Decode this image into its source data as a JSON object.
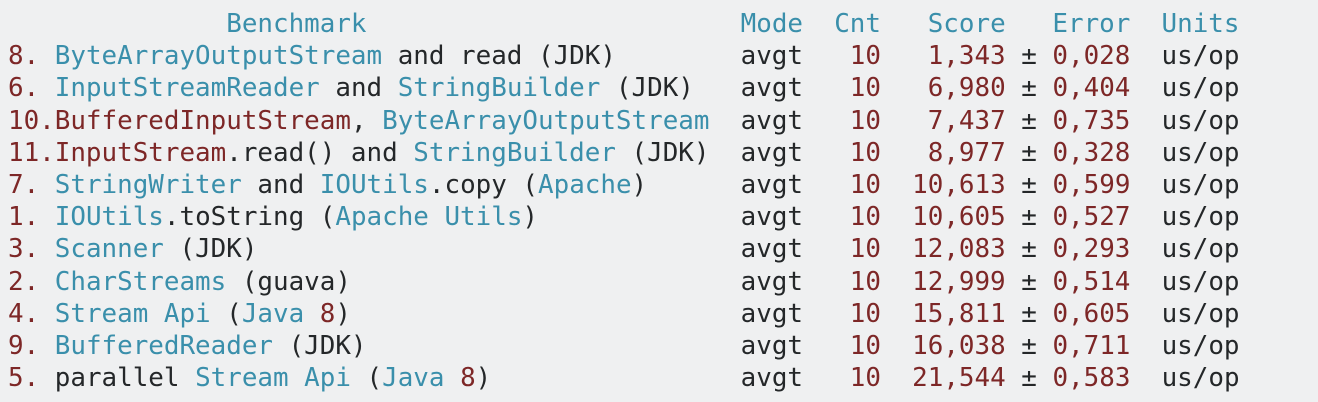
{
  "colors": {
    "teal": "#3a8fab",
    "red": "#7d2727",
    "text": "#242729",
    "background": "#eff0f1"
  },
  "header": {
    "benchmark": "Benchmark",
    "mode": "Mode",
    "cnt": "Cnt",
    "score": "Score",
    "error": "Error",
    "units": "Units",
    "plusminus": "±"
  },
  "rows": [
    {
      "name": [
        [
          "8. ",
          "r"
        ],
        [
          "ByteArrayOutputStream",
          "t"
        ],
        [
          " and read (JDK)",
          "k"
        ]
      ],
      "mode": "avgt",
      "cnt": "10",
      "score": "1,343",
      "error": "0,028",
      "units": "us/op"
    },
    {
      "name": [
        [
          "6. ",
          "r"
        ],
        [
          "InputStreamReader",
          "t"
        ],
        [
          " and ",
          "k"
        ],
        [
          "StringBuilder",
          "t"
        ],
        [
          " (JDK)",
          "k"
        ]
      ],
      "mode": "avgt",
      "cnt": "10",
      "score": "6,980",
      "error": "0,404",
      "units": "us/op"
    },
    {
      "name": [
        [
          "10.BufferedInputStream",
          "r"
        ],
        [
          ", ",
          "k"
        ],
        [
          "ByteArrayOutputStream",
          "t"
        ]
      ],
      "mode": "avgt",
      "cnt": "10",
      "score": "7,437",
      "error": "0,735",
      "units": "us/op"
    },
    {
      "name": [
        [
          "11.InputStream",
          "r"
        ],
        [
          ".read() and ",
          "k"
        ],
        [
          "StringBuilder",
          "t"
        ],
        [
          " (JDK)",
          "k"
        ]
      ],
      "mode": "avgt",
      "cnt": "10",
      "score": "8,977",
      "error": "0,328",
      "units": "us/op"
    },
    {
      "name": [
        [
          "7. ",
          "r"
        ],
        [
          "StringWriter",
          "t"
        ],
        [
          " and ",
          "k"
        ],
        [
          "IOUtils",
          "t"
        ],
        [
          ".copy (",
          "k"
        ],
        [
          "Apache",
          "t"
        ],
        [
          ")",
          "k"
        ]
      ],
      "mode": "avgt",
      "cnt": "10",
      "score": "10,613",
      "error": "0,599",
      "units": "us/op"
    },
    {
      "name": [
        [
          "1. ",
          "r"
        ],
        [
          "IOUtils",
          "t"
        ],
        [
          ".toString (",
          "k"
        ],
        [
          "Apache Utils",
          "t"
        ],
        [
          ")",
          "k"
        ]
      ],
      "mode": "avgt",
      "cnt": "10",
      "score": "10,605",
      "error": "0,527",
      "units": "us/op"
    },
    {
      "name": [
        [
          "3. ",
          "r"
        ],
        [
          "Scanner",
          "t"
        ],
        [
          " (JDK)",
          "k"
        ]
      ],
      "mode": "avgt",
      "cnt": "10",
      "score": "12,083",
      "error": "0,293",
      "units": "us/op"
    },
    {
      "name": [
        [
          "2. ",
          "r"
        ],
        [
          "CharStreams",
          "t"
        ],
        [
          " (guava)",
          "k"
        ]
      ],
      "mode": "avgt",
      "cnt": "10",
      "score": "12,999",
      "error": "0,514",
      "units": "us/op"
    },
    {
      "name": [
        [
          "4. ",
          "r"
        ],
        [
          "Stream Api",
          "t"
        ],
        [
          " (",
          "k"
        ],
        [
          "Java ",
          "t"
        ],
        [
          "8",
          "r"
        ],
        [
          ")",
          "k"
        ]
      ],
      "mode": "avgt",
      "cnt": "10",
      "score": "15,811",
      "error": "0,605",
      "units": "us/op"
    },
    {
      "name": [
        [
          "9. ",
          "r"
        ],
        [
          "BufferedReader",
          "t"
        ],
        [
          " (JDK)",
          "k"
        ]
      ],
      "mode": "avgt",
      "cnt": "10",
      "score": "16,038",
      "error": "0,711",
      "units": "us/op"
    },
    {
      "name": [
        [
          "5. ",
          "r"
        ],
        [
          "parallel ",
          "k"
        ],
        [
          "Stream Api",
          "t"
        ],
        [
          " (",
          "k"
        ],
        [
          "Java ",
          "t"
        ],
        [
          "8",
          "r"
        ],
        [
          ")",
          "k"
        ]
      ],
      "mode": "avgt",
      "cnt": "10",
      "score": "21,544",
      "error": "0,583",
      "units": "us/op"
    }
  ]
}
